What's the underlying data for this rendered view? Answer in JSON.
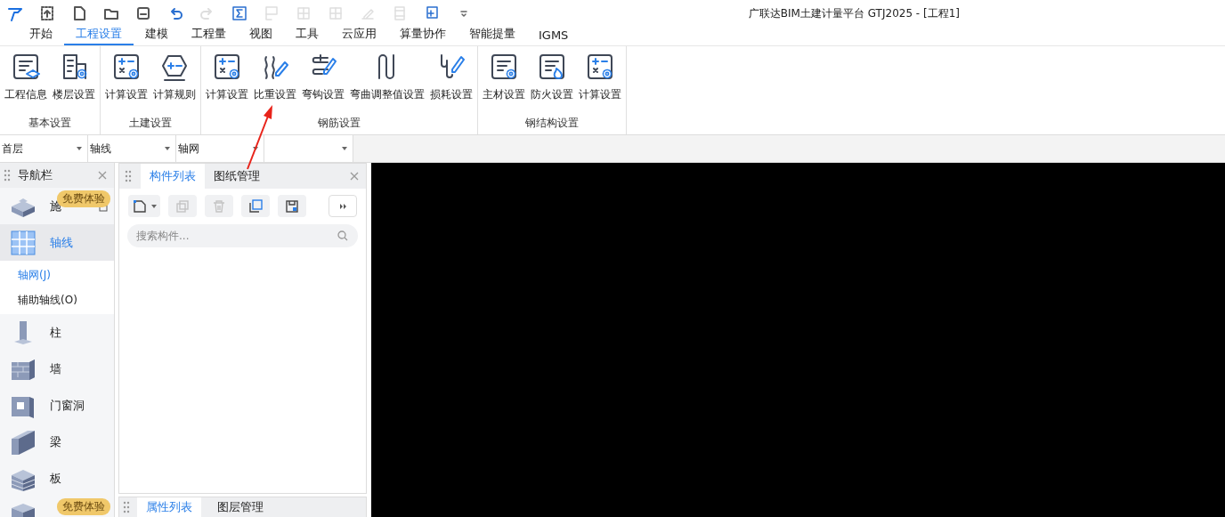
{
  "title_bar": {
    "title": "广联达BIM土建计量平台 GTJ2025 - [工程1]",
    "quick_access": [
      {
        "kind": "app",
        "disabled": false
      },
      {
        "kind": "upload",
        "disabled": false
      },
      {
        "kind": "new",
        "disabled": false
      },
      {
        "kind": "open",
        "disabled": false
      },
      {
        "kind": "save",
        "disabled": false
      },
      {
        "kind": "undo",
        "disabled": false
      },
      {
        "kind": "redo",
        "disabled": true
      },
      {
        "kind": "sum",
        "disabled": false
      },
      {
        "kind": "grid",
        "disabled": true
      },
      {
        "kind": "table",
        "disabled": true
      },
      {
        "kind": "table",
        "disabled": true
      },
      {
        "kind": "pen",
        "disabled": true
      },
      {
        "kind": "film",
        "disabled": true
      },
      {
        "kind": "add",
        "disabled": false
      },
      {
        "kind": "more",
        "disabled": false
      }
    ]
  },
  "menu_tabs": [
    {
      "label": "开始",
      "selected": false
    },
    {
      "label": "工程设置",
      "selected": true
    },
    {
      "label": "建模",
      "selected": false
    },
    {
      "label": "工程量",
      "selected": false
    },
    {
      "label": "视图",
      "selected": false
    },
    {
      "label": "工具",
      "selected": false
    },
    {
      "label": "云应用",
      "selected": false
    },
    {
      "label": "算量协作",
      "selected": false
    },
    {
      "label": "智能提量",
      "selected": false
    },
    {
      "label": "IGMS",
      "selected": false
    }
  ],
  "ribbon_groups": [
    {
      "label": "基本设置",
      "buttons": [
        {
          "label": "工程信息",
          "kind": "info"
        },
        {
          "label": "楼层设置",
          "kind": "floor"
        }
      ]
    },
    {
      "label": "土建设置",
      "buttons": [
        {
          "label": "计算设置",
          "kind": "calc"
        },
        {
          "label": "计算规则",
          "kind": "rule"
        }
      ]
    },
    {
      "label": "钢筋设置",
      "buttons": [
        {
          "label": "计算设置",
          "kind": "calc"
        },
        {
          "label": "比重设置",
          "kind": "ratio"
        },
        {
          "label": "弯钩设置",
          "kind": "hook"
        },
        {
          "label": "弯曲调整值设置",
          "kind": "bend"
        },
        {
          "label": "损耗设置",
          "kind": "loss"
        }
      ]
    },
    {
      "label": "钢结构设置",
      "buttons": [
        {
          "label": "主材设置",
          "kind": "material"
        },
        {
          "label": "防火设置",
          "kind": "fire"
        },
        {
          "label": "计算设置",
          "kind": "calc"
        }
      ]
    }
  ],
  "selectors": [
    {
      "value": "首层"
    },
    {
      "value": "轴线"
    },
    {
      "value": "轴网"
    }
  ],
  "nav_panel": {
    "title": "导航栏",
    "items": [
      {
        "label": "施",
        "kind": "segment",
        "selected": false,
        "badge": "免费体验",
        "locked": true
      },
      {
        "label": "轴线",
        "kind": "axis",
        "selected": true,
        "children": [
          {
            "label": "轴网(J)",
            "selected": true
          },
          {
            "label": "辅助轴线(O)",
            "selected": false
          }
        ]
      },
      {
        "label": "柱",
        "kind": "column",
        "selected": false
      },
      {
        "label": "墙",
        "kind": "wall",
        "selected": false
      },
      {
        "label": "门窗洞",
        "kind": "opening",
        "selected": false
      },
      {
        "label": "梁",
        "kind": "beam",
        "selected": false
      },
      {
        "label": "板",
        "kind": "slab",
        "selected": false
      },
      {
        "kind": "assembly",
        "selected": false,
        "badge": "免费体验"
      }
    ]
  },
  "component_panel": {
    "tabs": [
      {
        "label": "构件列表",
        "selected": true
      },
      {
        "label": "图纸管理",
        "selected": false
      }
    ],
    "toolbar": [
      {
        "kind": "new",
        "disabled": false,
        "dropdown": true
      },
      {
        "kind": "copy",
        "disabled": true
      },
      {
        "kind": "delete",
        "disabled": true
      },
      {
        "kind": "layer",
        "disabled": false
      },
      {
        "kind": "save",
        "disabled": false
      },
      {
        "kind": "more",
        "disabled": false
      }
    ],
    "search": {
      "placeholder": "搜索构件..."
    }
  },
  "property_panel": {
    "tabs": [
      {
        "label": "属性列表",
        "selected": true
      },
      {
        "label": "图层管理",
        "selected": false
      }
    ]
  }
}
